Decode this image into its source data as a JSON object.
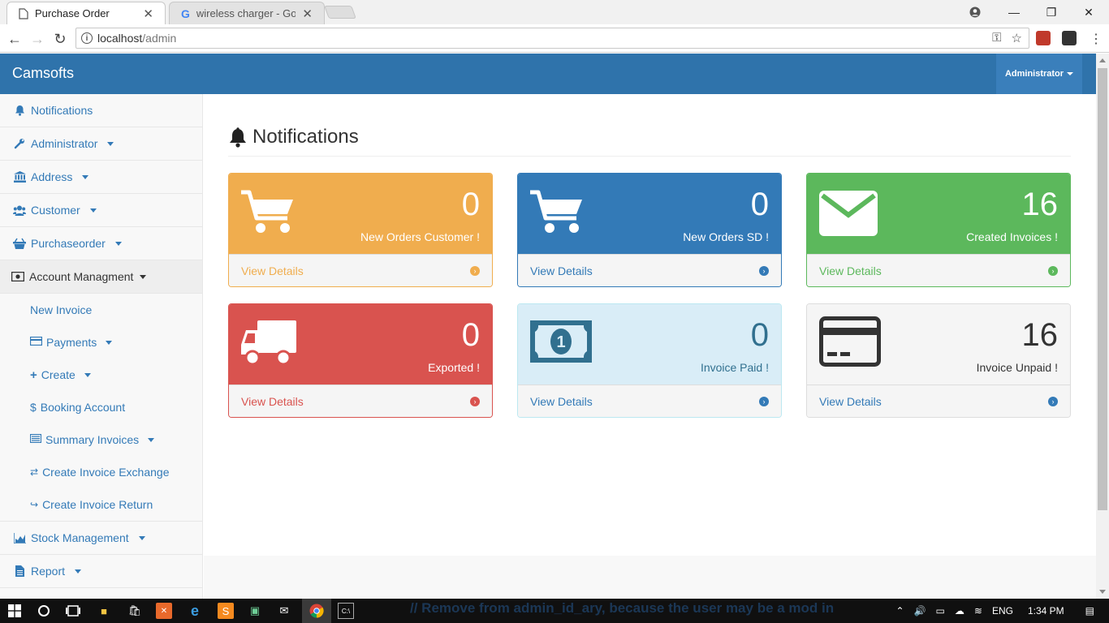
{
  "browser": {
    "tabs": [
      {
        "title": "Purchase Order",
        "active": true
      },
      {
        "title": "wireless charger - Google",
        "active": false
      }
    ],
    "url_host": "localhost",
    "url_path": "/admin"
  },
  "app": {
    "brand": "Camsofts",
    "user_menu": "Administrator"
  },
  "sidebar": {
    "items": [
      {
        "label": "Notifications",
        "icon": "bell-icon",
        "dropdown": false
      },
      {
        "label": "Administrator",
        "icon": "wrench-icon",
        "dropdown": true
      },
      {
        "label": "Address",
        "icon": "bank-icon",
        "dropdown": true
      },
      {
        "label": "Customer",
        "icon": "users-icon",
        "dropdown": true
      },
      {
        "label": "Purchaseorder",
        "icon": "basket-icon",
        "dropdown": true
      },
      {
        "label": "Account Managment",
        "icon": "money-icon",
        "dropdown": true,
        "expanded": true
      }
    ],
    "sub_items": [
      {
        "label": "New Invoice",
        "icon": "",
        "dropdown": false
      },
      {
        "label": "Payments",
        "icon": "credit-card-icon",
        "dropdown": true
      },
      {
        "label": "Create",
        "icon": "plus-icon",
        "dropdown": true
      },
      {
        "label": "Booking Account",
        "icon": "dollar-icon",
        "dropdown": false
      },
      {
        "label": "Summary Invoices",
        "icon": "list-icon",
        "dropdown": true
      },
      {
        "label": "Create Invoice Exchange",
        "icon": "exchange-icon",
        "dropdown": false
      },
      {
        "label": "Create Invoice Return",
        "icon": "share-icon",
        "dropdown": false
      }
    ],
    "bottom_items": [
      {
        "label": "Stock Management",
        "icon": "area-chart-icon",
        "dropdown": true
      },
      {
        "label": "Report",
        "icon": "file-icon",
        "dropdown": true
      }
    ]
  },
  "page": {
    "title": "Notifications"
  },
  "panels": [
    {
      "value": "0",
      "label": "New Orders Customer !",
      "link": "View Details",
      "icon": "cart-icon",
      "color": "#f0ad4e"
    },
    {
      "value": "0",
      "label": "New Orders SD !",
      "link": "View Details",
      "icon": "cart-icon",
      "color": "#337ab7"
    },
    {
      "value": "16",
      "label": "Created Invoices !",
      "link": "View Details",
      "icon": "envelope-icon",
      "color": "#5cb85c"
    },
    {
      "value": "0",
      "label": "Exported !",
      "link": "View Details",
      "icon": "truck-icon",
      "color": "#d9534f"
    },
    {
      "value": "0",
      "label": "Invoice Paid !",
      "link": "View Details",
      "icon": "money-icon",
      "color": "#31708f"
    },
    {
      "value": "16",
      "label": "Invoice Unpaid !",
      "link": "View Details",
      "icon": "credit-card-icon",
      "color": "#333333"
    }
  ],
  "taskbar": {
    "overlay_text": "// Remove from admin_id_ary, because the user may be a mod in",
    "language": "ENG",
    "time": "1:34 PM"
  }
}
